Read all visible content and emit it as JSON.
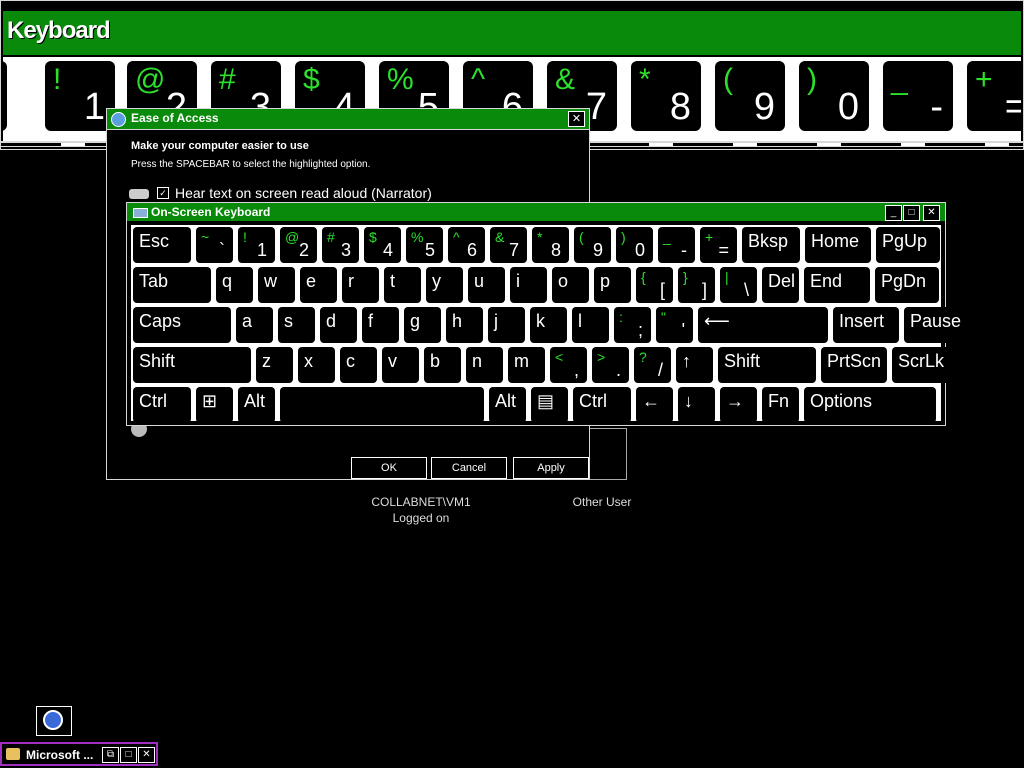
{
  "big_keyboard": {
    "title": "Keyboard",
    "keys": [
      {
        "shift": "",
        "main": "`"
      },
      {
        "shift": "!",
        "main": "1"
      },
      {
        "shift": "@",
        "main": "2"
      },
      {
        "shift": "#",
        "main": "3"
      },
      {
        "shift": "$",
        "main": "4"
      },
      {
        "shift": "%",
        "main": "5"
      },
      {
        "shift": "^",
        "main": "6"
      },
      {
        "shift": "&",
        "main": "7"
      },
      {
        "shift": "*",
        "main": "8"
      },
      {
        "shift": "(",
        "main": "9"
      },
      {
        "shift": ")",
        "main": "0"
      },
      {
        "shift": "_",
        "main": "-"
      },
      {
        "shift": "+",
        "main": "="
      }
    ]
  },
  "ease_dialog": {
    "title": "Ease of Access",
    "heading": "Make your computer easier to use",
    "subtext": "Press the SPACEBAR to select the highlighted option.",
    "checkbox_label": "Hear text on screen read aloud (Narrator)",
    "checkbox_checked": true,
    "ok_label": "OK",
    "cancel_label": "Cancel",
    "apply_label": "Apply",
    "close_glyph": "✕"
  },
  "users": {
    "user1_name": "COLLABNET\\VM1",
    "user1_status": "Logged on",
    "user2_name": "Other User"
  },
  "osk": {
    "title": "On-Screen Keyboard",
    "minimize": "_",
    "maximize": "□",
    "close": "✕",
    "rows": [
      [
        {
          "main": "Esc"
        },
        {
          "shift": "~",
          "lower": "`"
        },
        {
          "shift": "!",
          "lower": "1"
        },
        {
          "shift": "@",
          "lower": "2"
        },
        {
          "shift": "#",
          "lower": "3"
        },
        {
          "shift": "$",
          "lower": "4"
        },
        {
          "shift": "%",
          "lower": "5"
        },
        {
          "shift": "^",
          "lower": "6"
        },
        {
          "shift": "&",
          "lower": "7"
        },
        {
          "shift": "*",
          "lower": "8"
        },
        {
          "shift": "(",
          "lower": "9"
        },
        {
          "shift": ")",
          "lower": "0"
        },
        {
          "shift": "_",
          "lower": "-"
        },
        {
          "shift": "+",
          "lower": "="
        },
        {
          "main": "Bksp"
        },
        {
          "main": "Home"
        },
        {
          "main": "PgUp"
        }
      ],
      [
        {
          "main": "Tab"
        },
        {
          "main": "q"
        },
        {
          "main": "w"
        },
        {
          "main": "e"
        },
        {
          "main": "r"
        },
        {
          "main": "t"
        },
        {
          "main": "y"
        },
        {
          "main": "u"
        },
        {
          "main": "i"
        },
        {
          "main": "o"
        },
        {
          "main": "p"
        },
        {
          "shift": "{",
          "lower": "["
        },
        {
          "shift": "}",
          "lower": "]"
        },
        {
          "shift": "|",
          "lower": "\\"
        },
        {
          "main": "Del"
        },
        {
          "main": "End"
        },
        {
          "main": "PgDn"
        }
      ],
      [
        {
          "main": "Caps"
        },
        {
          "main": "a"
        },
        {
          "main": "s"
        },
        {
          "main": "d"
        },
        {
          "main": "f"
        },
        {
          "main": "g"
        },
        {
          "main": "h"
        },
        {
          "main": "j"
        },
        {
          "main": "k"
        },
        {
          "main": "l"
        },
        {
          "shift": ":",
          "lower": ";"
        },
        {
          "shift": "\"",
          "lower": "'"
        },
        {
          "main": "⟵"
        },
        {
          "main": "Insert"
        },
        {
          "main": "Pause"
        }
      ],
      [
        {
          "main": "Shift"
        },
        {
          "main": "z"
        },
        {
          "main": "x"
        },
        {
          "main": "c"
        },
        {
          "main": "v"
        },
        {
          "main": "b"
        },
        {
          "main": "n"
        },
        {
          "main": "m"
        },
        {
          "shift": "<",
          "lower": ","
        },
        {
          "shift": ">",
          "lower": "."
        },
        {
          "shift": "?",
          "lower": "/"
        },
        {
          "main": "↑"
        },
        {
          "main": "Shift"
        },
        {
          "main": "PrtScn"
        },
        {
          "main": "ScrLk"
        }
      ],
      [
        {
          "main": "Ctrl"
        },
        {
          "main": "⊞"
        },
        {
          "main": "Alt"
        },
        {
          "main": ""
        },
        {
          "main": "Alt"
        },
        {
          "main": "▤"
        },
        {
          "main": "Ctrl"
        },
        {
          "main": "←"
        },
        {
          "main": "↓"
        },
        {
          "main": "→"
        },
        {
          "main": "Fn"
        },
        {
          "main": "Options"
        }
      ]
    ]
  },
  "taskbar": {
    "task_title": "Microsoft ...",
    "restore": "⧉",
    "maximize": "□",
    "close": "✕"
  }
}
